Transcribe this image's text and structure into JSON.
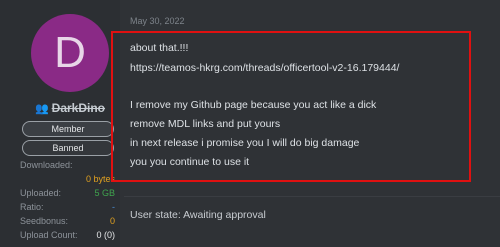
{
  "user": {
    "avatar_letter": "D",
    "username": "DarkDino",
    "badges": [
      "Member",
      "Banned"
    ]
  },
  "stats": [
    {
      "label": "Downloaded:",
      "value": "",
      "color": "#8d939a"
    },
    {
      "label": "",
      "value": "0 bytes",
      "color": "#e0a020"
    },
    {
      "label": "Uploaded:",
      "value": "5 GB",
      "color": "#3fa34d"
    },
    {
      "label": "Ratio:",
      "value": "-",
      "color": "#4a8fd8"
    },
    {
      "label": "Seedbonus:",
      "value": "0",
      "color": "#e0a020"
    },
    {
      "label": "Upload Count:",
      "value": "0 (0)",
      "color": "#e4e6e8"
    }
  ],
  "post": {
    "date": "May 30, 2022",
    "lines": [
      "about that.!!!",
      "https://teamos-hkrg.com/threads/officertool-v2-16.179444/",
      "",
      "I remove my Github page because you act like a dick",
      "remove MDL links and put yours",
      "in next release i promise you I will do big damage",
      "you you continue to use it"
    ],
    "user_state": "User state: Awaiting approval"
  },
  "colors": {
    "highlight_border": "#e01010",
    "avatar_bg": "#8a2a86"
  }
}
